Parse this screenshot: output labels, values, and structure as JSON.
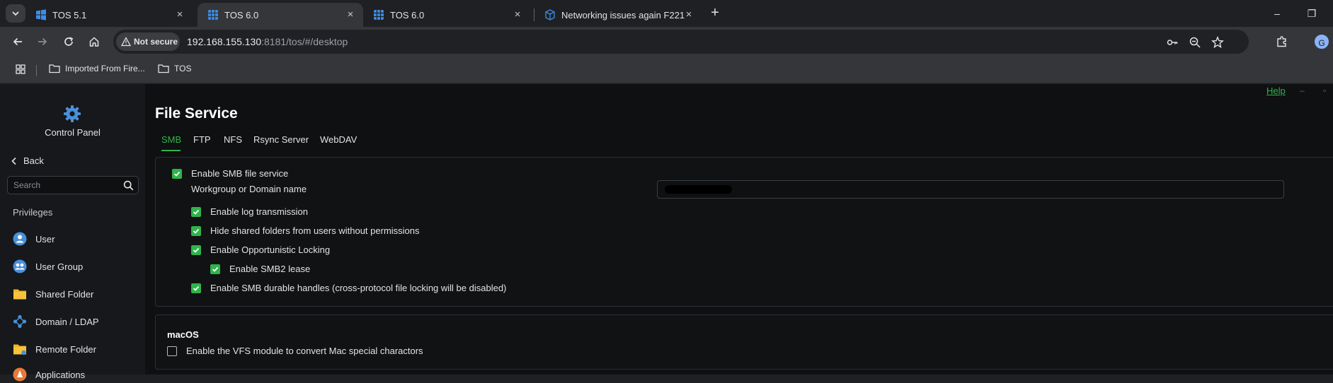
{
  "browser": {
    "tabs": [
      {
        "title": "TOS 5.1",
        "active": false
      },
      {
        "title": "TOS 6.0",
        "active": true
      },
      {
        "title": "TOS 6.0",
        "active": false
      },
      {
        "title": "Networking issues again F221 -",
        "active": false
      }
    ],
    "close_glyph": "×",
    "new_tab_glyph": "+",
    "security_label": "Not secure",
    "url_host": "192.168.155.130",
    "url_path": ":8181/tos/#/desktop",
    "avatar_letter": "G",
    "bookmarks": [
      {
        "label": "Imported From Fire..."
      },
      {
        "label": "TOS"
      }
    ],
    "window_min_glyph": "–",
    "window_restore_glyph": "❐"
  },
  "sidebar": {
    "app_title": "Control Panel",
    "back_label": "Back",
    "search_placeholder": "Search",
    "section_title": "Privileges",
    "items": [
      {
        "label": "User",
        "icon": "user-icon"
      },
      {
        "label": "User Group",
        "icon": "user-group-icon"
      },
      {
        "label": "Shared Folder",
        "icon": "shared-folder-icon"
      },
      {
        "label": "Domain / LDAP",
        "icon": "domain-ldap-icon"
      },
      {
        "label": "Remote Folder",
        "icon": "remote-folder-icon"
      },
      {
        "label": "Applications",
        "icon": "applications-icon"
      }
    ]
  },
  "main": {
    "help_label": "Help",
    "minimize_glyph": "–",
    "maximize_glyph": "▫",
    "title": "File Service",
    "tabs": [
      "SMB",
      "FTP",
      "NFS",
      "Rsync Server",
      "WebDAV"
    ],
    "active_tab": "SMB",
    "smb": {
      "enable_label": "Enable SMB file service",
      "enable_checked": true,
      "workgroup_label": "Workgroup or Domain name",
      "options": [
        {
          "label": "Enable log transmission",
          "checked": true,
          "indent": 1
        },
        {
          "label": "Hide shared folders from users without permissions",
          "checked": true,
          "indent": 1
        },
        {
          "label": "Enable Opportunistic Locking",
          "checked": true,
          "indent": 1
        },
        {
          "label": "Enable SMB2 lease",
          "checked": true,
          "indent": 2
        },
        {
          "label": "Enable SMB durable handles (cross-protocol file locking will be disabled)",
          "checked": true,
          "indent": 1
        }
      ]
    },
    "macos": {
      "title": "macOS",
      "vfs_label": "Enable the VFS module to convert Mac special charactors",
      "vfs_checked": false
    }
  },
  "colors": {
    "accent_green": "#2fb44a",
    "background": "#0f1012",
    "sidebar_bg": "#16181b"
  }
}
